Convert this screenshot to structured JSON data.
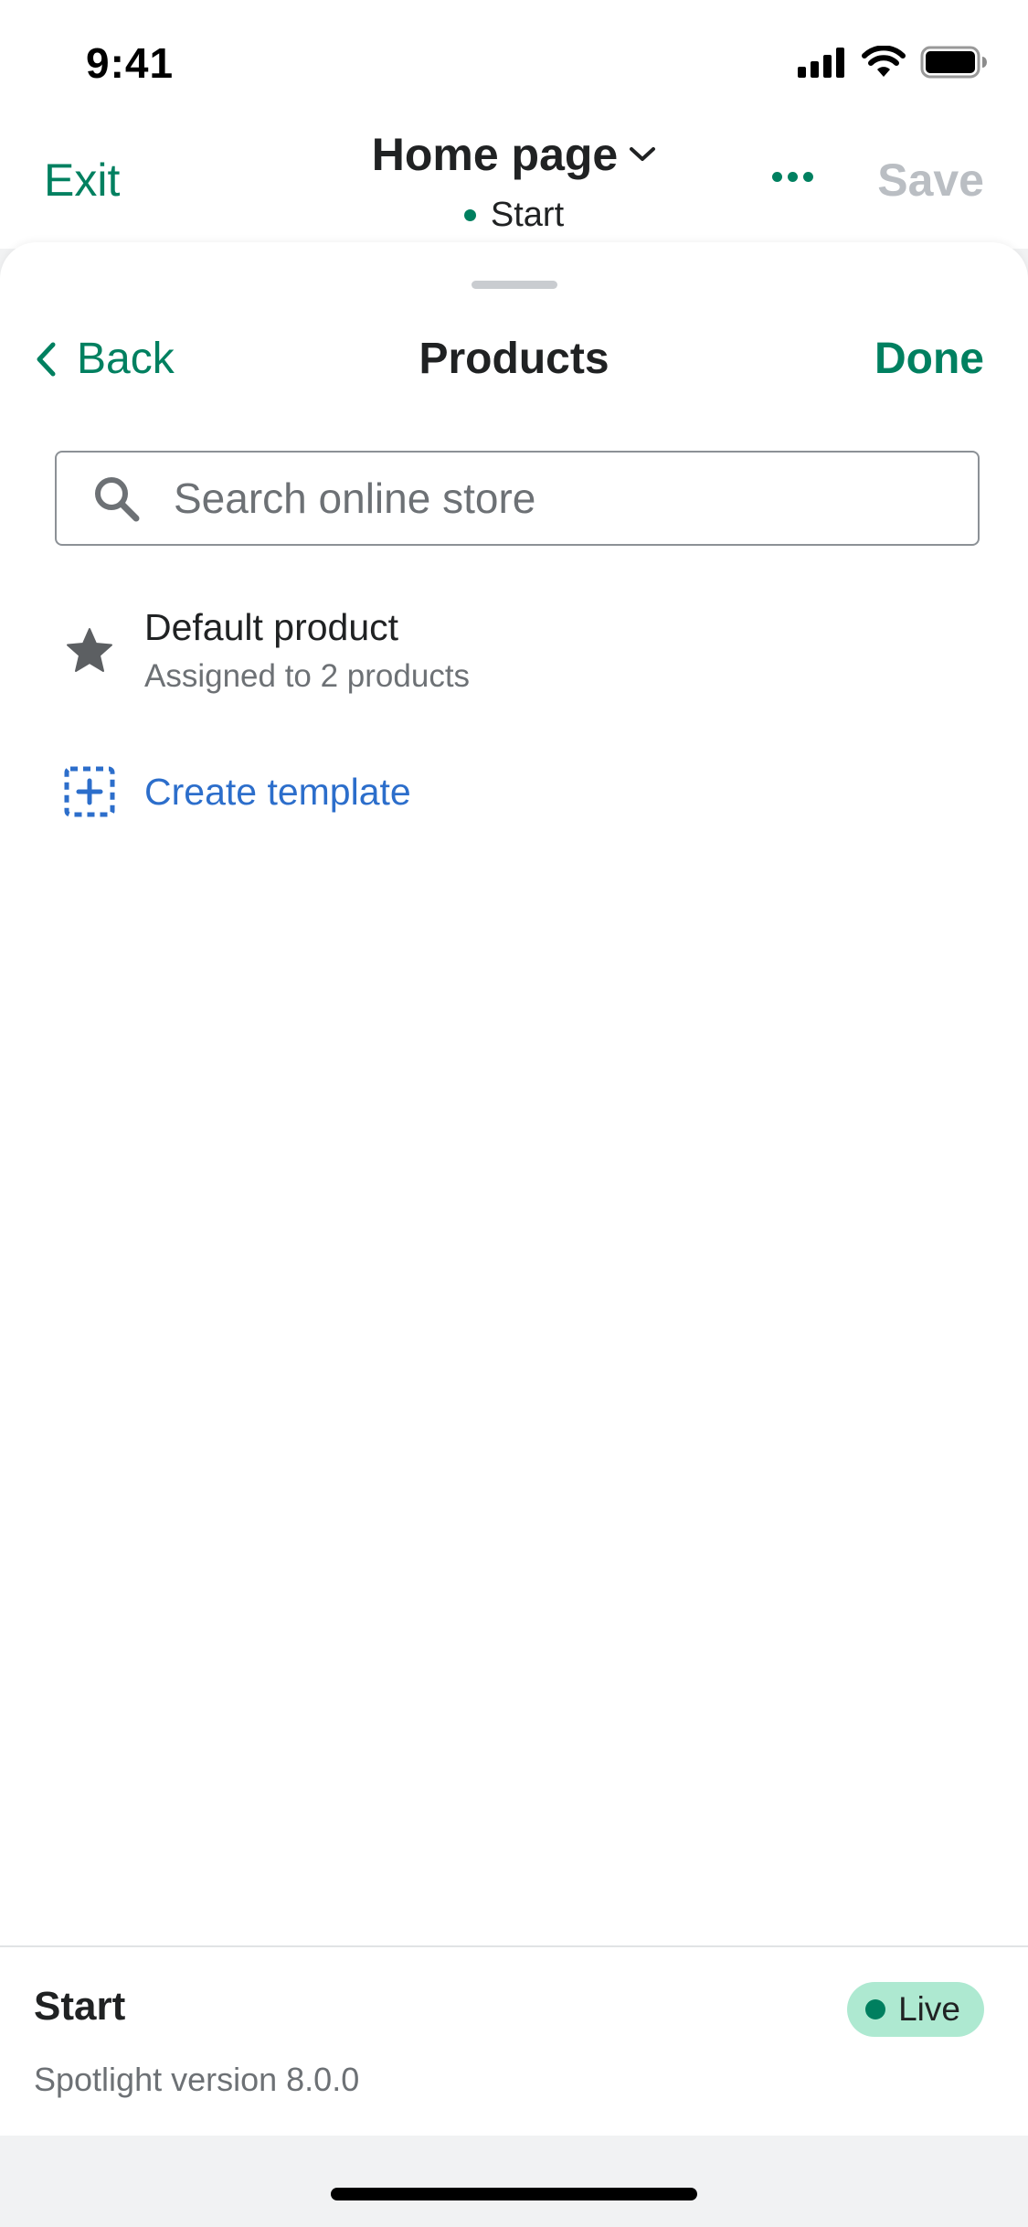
{
  "status_bar": {
    "time": "9:41",
    "icons": [
      "cellular-signal-icon",
      "wifi-icon",
      "battery-icon"
    ]
  },
  "topbar": {
    "exit_label": "Exit",
    "page_title": "Home page",
    "theme_name": "Start",
    "save_label": "Save"
  },
  "sheet": {
    "back_label": "Back",
    "title": "Products",
    "done_label": "Done",
    "search": {
      "placeholder": "Search online store",
      "value": ""
    },
    "templates": [
      {
        "title": "Default product",
        "subtitle": "Assigned to 2 products",
        "icon": "star-icon"
      }
    ],
    "create_label": "Create template"
  },
  "footer": {
    "theme_name": "Start",
    "status_label": "Live",
    "version": "Spotlight version 8.0.0"
  },
  "colors": {
    "accent": "#008060",
    "link": "#2c6ecb",
    "badge_bg": "#aee9d1",
    "muted": "#6d7175",
    "disabled": "#babec3"
  }
}
